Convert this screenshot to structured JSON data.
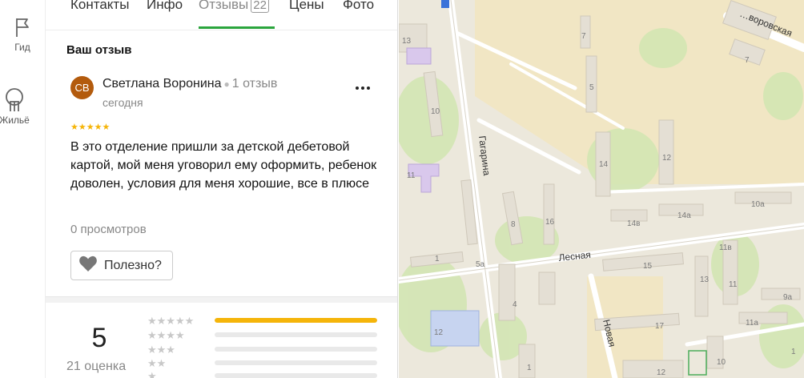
{
  "rail": {
    "items": [
      {
        "label": "Гид",
        "icon": "flag-icon"
      },
      {
        "label": "Жильё",
        "icon": "house-icon"
      }
    ]
  },
  "tabs": [
    {
      "label": "Контакты"
    },
    {
      "label": "Инфо"
    },
    {
      "label": "Отзывы",
      "count": "22",
      "active": true
    },
    {
      "label": "Цены"
    },
    {
      "label": "Фото"
    }
  ],
  "review": {
    "section_title": "Ваш отзыв",
    "avatar_initials": "СВ",
    "author": "Светлана Воронина",
    "author_reviews": "1 отзыв",
    "date": "сегодня",
    "rating": 5,
    "stars": "★★★★★",
    "text": "В это отделение пришли за детской дебетовой картой, мой меня уговорил ему оформить, ребенок доволен, условия для меня хорошие, все в плюсе",
    "views": "0 просмотров",
    "useful_label": "Полезно?"
  },
  "summary": {
    "rating": "5",
    "count_label": "21 оценка",
    "distribution": [
      {
        "stars": "★★★★★",
        "fraction": 1.0
      },
      {
        "stars": "★★★★",
        "fraction": 0
      },
      {
        "stars": "★★★",
        "fraction": 0
      },
      {
        "stars": "★★",
        "fraction": 0
      },
      {
        "stars": "★",
        "fraction": 0
      }
    ]
  },
  "map": {
    "streets": [
      "Гагарина",
      "Лесная",
      "Новая",
      "…воровская"
    ],
    "house_numbers": [
      "13",
      "10",
      "11",
      "7",
      "5",
      "14",
      "12",
      "8",
      "16",
      "1",
      "5а",
      "4",
      "12",
      "14в",
      "14а",
      "10а",
      "11в",
      "15",
      "13",
      "11",
      "9а",
      "17",
      "11а",
      "10",
      "12",
      "7",
      "1",
      "1"
    ]
  },
  "colors": {
    "accent": "#2aa53d",
    "star": "#f5b50a",
    "avatar": "#b35b0d"
  }
}
